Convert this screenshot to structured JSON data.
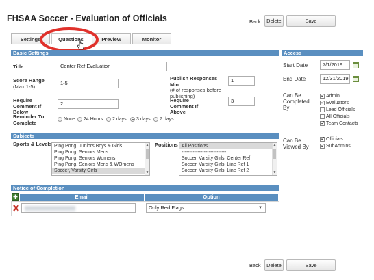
{
  "header": {
    "title": "FHSAA Soccer - Evaluation of Officials",
    "back": "Back",
    "delete": "Delete",
    "save": "Save"
  },
  "tabs": [
    {
      "label": "Settings"
    },
    {
      "label": "Questions"
    },
    {
      "label": "Preview"
    },
    {
      "label": "Monitor"
    }
  ],
  "basic": {
    "header": "Basic Settings",
    "title_label": "Title",
    "title_value": "Center Ref Evaluation",
    "score_label": "Score Range",
    "score_sub": "(Max 1-5)",
    "score_value": "1-5",
    "publish_label": "Publish Responses Min",
    "publish_sub": "(# of responses before publishing)",
    "publish_value": "1",
    "req_below_label": "Require Comment If Below",
    "req_below_value": "2",
    "req_above_label": "Require Comment If Above",
    "req_above_value": "3",
    "reminder_label": "Reminder To Complete",
    "reminder_options": [
      "None",
      "24 Hours",
      "2 days",
      "3 days",
      "7 days"
    ],
    "reminder_selected": "3 days"
  },
  "subjects": {
    "header": "Subjects",
    "sports_label": "Sports & Levels",
    "sports": [
      "Ping Pong, Juniors Boys & Girls",
      "Ping Pong, Seniors Mens",
      "Ping Pong, Seniors Womens",
      "Ping Pong, Seniors Mens & WOmens",
      "Soccer, Varsity Girls"
    ],
    "positions_label": "Positions",
    "positions": [
      "All Positions",
      "----------------------------",
      "Soccer, Varsity Girls, Center Ref",
      "Soccer, Varsity Girls, Line Ref 1",
      "Soccer, Varsity Girls, Line Ref 2"
    ]
  },
  "access": {
    "header": "Access",
    "start_label": "Start Date",
    "start_value": "7/1/2019",
    "end_label": "End Date",
    "end_value": "12/31/2019",
    "completed_label": "Can Be Completed By",
    "completed": [
      {
        "label": "Admin",
        "checked": true
      },
      {
        "label": "Evaluators",
        "checked": true
      },
      {
        "label": "Lead Officials",
        "checked": false
      },
      {
        "label": "All Officials",
        "checked": false
      },
      {
        "label": "Team Contacts",
        "checked": true
      }
    ],
    "viewed_label": "Can Be Viewed By",
    "viewed": [
      {
        "label": "Officials",
        "checked": true
      },
      {
        "label": "SubAdmins",
        "checked": true
      }
    ]
  },
  "notice": {
    "header": "Notice of Completion",
    "col_email": "Email",
    "col_option": "Option",
    "option_value": "Only Red Flags"
  },
  "footer": {
    "back": "Back",
    "delete": "Delete",
    "save": "Save"
  },
  "colors": {
    "section_header": "#5a8fc0",
    "highlight_circle": "#e0312b"
  }
}
